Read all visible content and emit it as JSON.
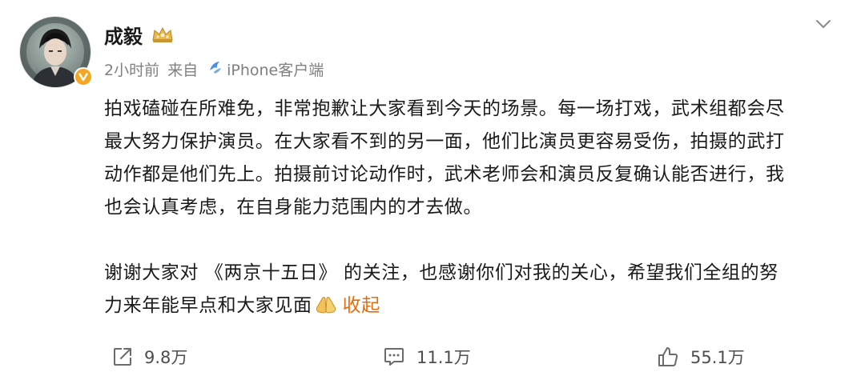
{
  "post": {
    "username": "成毅",
    "time": "2小时前",
    "source_prefix": "来自",
    "source": "iPhone客户端",
    "paragraph1": [
      "拍戏磕碰在所难免，非常抱歉让大家看到今天的场景。每一场打戏，武术组都会尽",
      "最大努力保护演员。在大家看不到的另一面，他们比演员更容易受伤，拍摄的武打",
      "动作都是他们先上。拍摄前讨论动作时，武术老师会和演员反复确认能否进行，我",
      "也会认真考虑，在自身能力范围内的才去做。"
    ],
    "paragraph2": [
      "谢谢大家对 《两京十五日》 的关注，也感谢你们对我的关心，希望我们全组的努",
      "力来年能早点和大家见面"
    ],
    "collapse_label": "收起"
  },
  "actions": {
    "reposts": "9.8万",
    "comments": "11.1万",
    "likes": "55.1万"
  },
  "icons": {
    "header": [
      "avatar",
      "verified-icon",
      "vip-crown-icon",
      "chevron-down-icon"
    ],
    "meta": [
      "phone-icon"
    ],
    "inline": [
      "pray-hands-icon"
    ],
    "actions": [
      "repost-icon",
      "comment-icon",
      "like-icon"
    ]
  },
  "colors": {
    "text": "#1a1a1a",
    "meta": "#808080",
    "link": "#e86b0b",
    "verified": "#f5a623",
    "source_icon": "#4a90e2"
  }
}
